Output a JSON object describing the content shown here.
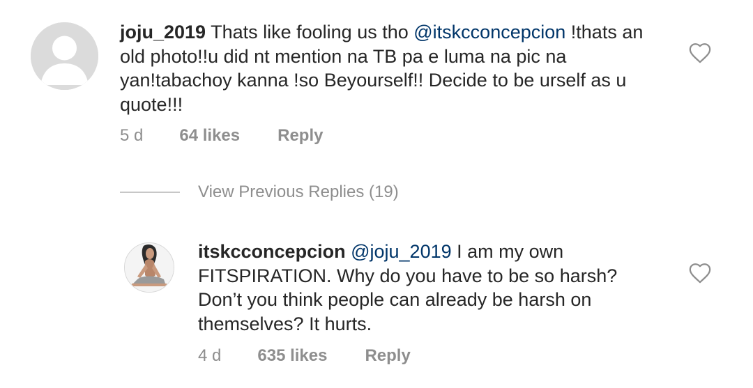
{
  "comments": [
    {
      "username": "joju_2019",
      "text_before": " Thats like fooling us tho ",
      "mention": "@itskcconcepcion",
      "text_after": " !thats an old photo!!u did nt mention na TB  pa e luma na pic na yan!tabachoy kanna !so Beyourself!! Decide to be urself as u quote!!!",
      "age": "5 d",
      "likes": "64 likes",
      "reply_label": "Reply",
      "avatar": "default-avatar",
      "like_icon": "heart-outline-icon"
    },
    {
      "username": "itskcconcepcion",
      "text_before": " ",
      "mention": "@joju_2019",
      "text_after": " I am my own FITSPIRATION. Why do you have to be so harsh? Don’t you think people can already be harsh on themselves? It hurts.",
      "age": "4 d",
      "likes": "635 likes",
      "reply_label": "Reply",
      "avatar": "profile-photo",
      "like_icon": "heart-outline-icon"
    }
  ],
  "view_replies": {
    "label": "View Previous Replies (19)"
  },
  "colors": {
    "text": "#262626",
    "mention": "#003569",
    "secondary": "#8e8e8e",
    "divider": "#c7c7c7",
    "avatar_placeholder": "#dbdbdb"
  }
}
